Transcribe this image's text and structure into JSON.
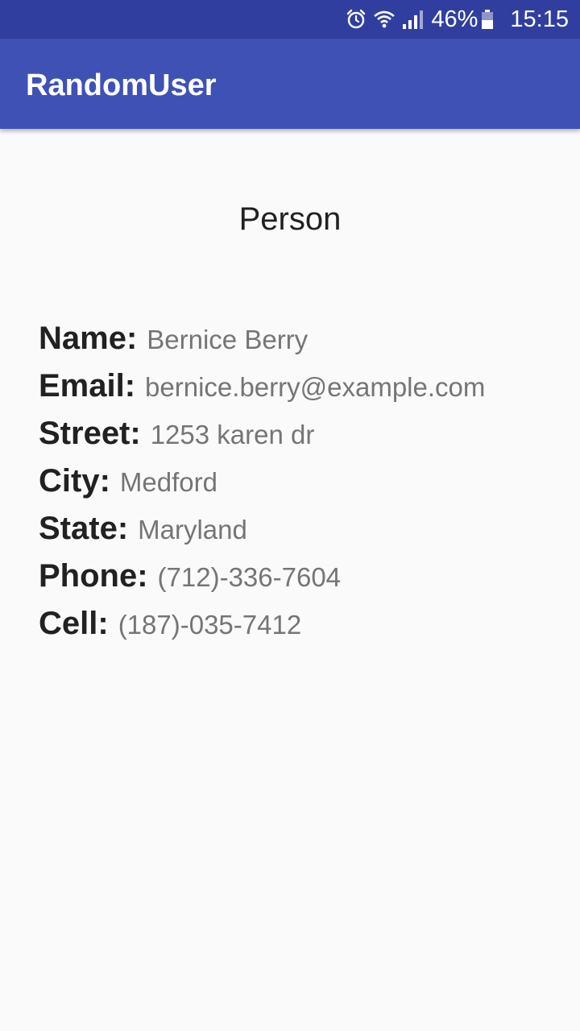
{
  "status_bar": {
    "icons": [
      "alarm-icon",
      "wifi-icon",
      "signal-icon",
      "battery-icon"
    ],
    "battery_percent": "46%",
    "time": "15:15"
  },
  "app_bar": {
    "title": "RandomUser"
  },
  "person": {
    "heading": "Person",
    "fields": [
      {
        "label": "Name:",
        "value": "Bernice Berry"
      },
      {
        "label": "Email:",
        "value": "bernice.berry@example.com"
      },
      {
        "label": "Street:",
        "value": "1253 karen dr"
      },
      {
        "label": "City:",
        "value": "Medford"
      },
      {
        "label": "State:",
        "value": "Maryland"
      },
      {
        "label": "Phone:",
        "value": "(712)-336-7604"
      },
      {
        "label": "Cell:",
        "value": "(187)-035-7412"
      }
    ]
  },
  "colors": {
    "status_bar": "#303f9f",
    "primary": "#3f51b5",
    "background": "#fafafa",
    "label_text": "#212121",
    "value_text": "#757575"
  }
}
